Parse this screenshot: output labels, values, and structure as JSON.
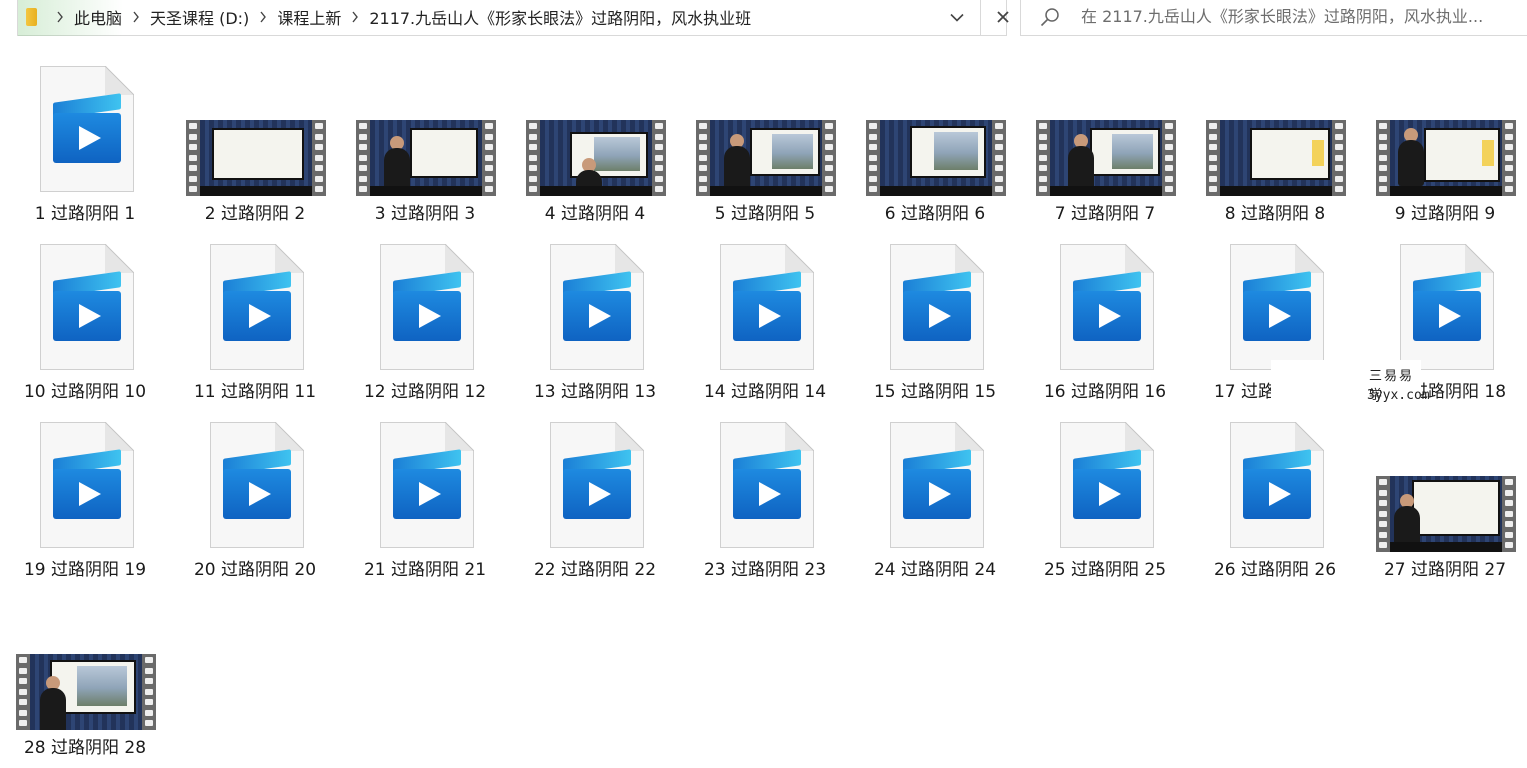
{
  "address_bar": {
    "breadcrumbs": [
      "此电脑",
      "天圣课程 (D:)",
      "课程上新",
      "2117.九岳山人《形家长眼法》过路阴阳，风水执业班"
    ],
    "icons": {
      "folder": "folder-icon",
      "separator": "chevron-right-icon",
      "dropdown": "chevron-down-icon",
      "close": "close-icon"
    }
  },
  "search": {
    "placeholder": "在 2117.九岳山人《形家长眼法》过路阴阳，风水执业..."
  },
  "files": [
    {
      "name": "1 过路阴阳 1",
      "thumb": "generic"
    },
    {
      "name": "2 过路阴阳 2",
      "thumb": "film"
    },
    {
      "name": "3 过路阴阳 3",
      "thumb": "film"
    },
    {
      "name": "4 过路阴阳 4",
      "thumb": "film"
    },
    {
      "name": "5 过路阴阳 5",
      "thumb": "film"
    },
    {
      "name": "6 过路阴阳 6",
      "thumb": "film"
    },
    {
      "name": "7 过路阴阳 7",
      "thumb": "film"
    },
    {
      "name": "8 过路阴阳 8",
      "thumb": "film"
    },
    {
      "name": "9 过路阴阳 9",
      "thumb": "film"
    },
    {
      "name": "10 过路阴阳 10",
      "thumb": "generic"
    },
    {
      "name": "11 过路阴阳 11",
      "thumb": "generic"
    },
    {
      "name": "12 过路阴阳 12",
      "thumb": "generic"
    },
    {
      "name": "13 过路阴阳 13",
      "thumb": "generic"
    },
    {
      "name": "14 过路阴阳 14",
      "thumb": "generic"
    },
    {
      "name": "15 过路阴阳 15",
      "thumb": "generic"
    },
    {
      "name": "16 过路阴阳 16",
      "thumb": "generic"
    },
    {
      "name": "17 过路阴阳 17",
      "thumb": "generic"
    },
    {
      "name": "18 过路阴阳 18",
      "thumb": "generic"
    },
    {
      "name": "19 过路阴阳 19",
      "thumb": "generic"
    },
    {
      "name": "20 过路阴阳 20",
      "thumb": "generic"
    },
    {
      "name": "21 过路阴阳 21",
      "thumb": "generic"
    },
    {
      "name": "22 过路阴阳 22",
      "thumb": "generic"
    },
    {
      "name": "23 过路阴阳 23",
      "thumb": "generic"
    },
    {
      "name": "24 过路阴阳 24",
      "thumb": "generic"
    },
    {
      "name": "25 过路阴阳 25",
      "thumb": "generic"
    },
    {
      "name": "26 过路阴阳 26",
      "thumb": "generic"
    },
    {
      "name": "27 过路阴阳 27",
      "thumb": "film"
    },
    {
      "name": "28 过路阴阳 28",
      "thumb": "film"
    }
  ],
  "watermark": {
    "cn": "三易易学",
    "en": "3yyx.com"
  },
  "colors": {
    "accent_blue": "#1e8ae0",
    "border": "#d9d9d9",
    "text": "#1a1a1a"
  }
}
